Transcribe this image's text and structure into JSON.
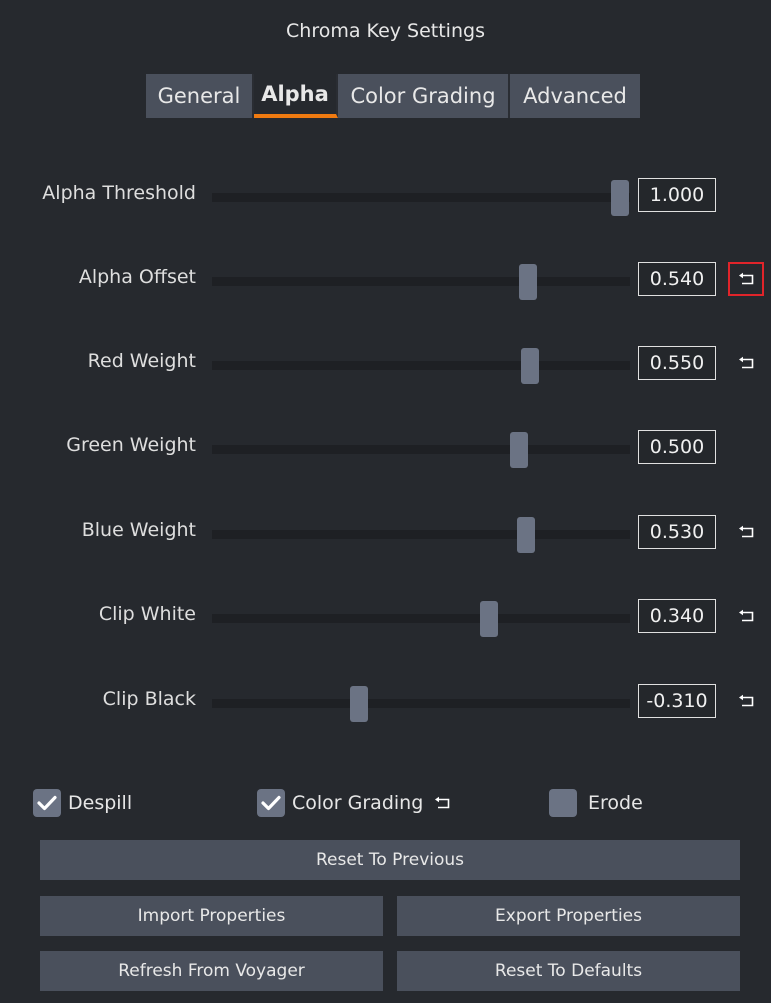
{
  "window": {
    "title": "Chroma Key Settings"
  },
  "tabs": [
    {
      "label": "General",
      "active": false
    },
    {
      "label": "Alpha",
      "active": true
    },
    {
      "label": "Color Grading",
      "active": false
    },
    {
      "label": "Advanced",
      "active": false
    }
  ],
  "sliders": [
    {
      "label": "Alpha Threshold",
      "value": "1.000",
      "fraction": 0.977,
      "reset_icon": false,
      "reset_highlighted": false
    },
    {
      "label": "Alpha Offset",
      "value": "0.540",
      "fraction": 0.756,
      "reset_icon": true,
      "reset_highlighted": true
    },
    {
      "label": "Red Weight",
      "value": "0.550",
      "fraction": 0.761,
      "reset_icon": true,
      "reset_highlighted": false
    },
    {
      "label": "Green Weight",
      "value": "0.500",
      "fraction": 0.734,
      "reset_icon": false,
      "reset_highlighted": false
    },
    {
      "label": "Blue Weight",
      "value": "0.530",
      "fraction": 0.751,
      "reset_icon": true,
      "reset_highlighted": false
    },
    {
      "label": "Clip White",
      "value": "0.340",
      "fraction": 0.663,
      "reset_icon": true,
      "reset_highlighted": false
    },
    {
      "label": "Clip Black",
      "value": "-0.310",
      "fraction": 0.352,
      "reset_icon": true,
      "reset_highlighted": false
    }
  ],
  "checkboxes": [
    {
      "label": "Despill",
      "checked": true,
      "reset_icon": false
    },
    {
      "label": "Color Grading",
      "checked": true,
      "reset_icon": true
    },
    {
      "label": "Erode",
      "checked": false,
      "reset_icon": false
    }
  ],
  "buttons": {
    "reset_to_previous": "Reset To Previous",
    "import_properties": "Import Properties",
    "export_properties": "Export Properties",
    "refresh_from_voyager": "Refresh From Voyager",
    "reset_to_defaults": "Reset To Defaults"
  },
  "colors": {
    "background": "#26292e",
    "tab_active_underline": "#f07a10",
    "highlight_border": "#e0242a",
    "thumb": "#6b7384",
    "button": "#4a505c"
  },
  "icons": {
    "reset": "reset-to-default-icon",
    "check": "checkmark-icon"
  }
}
